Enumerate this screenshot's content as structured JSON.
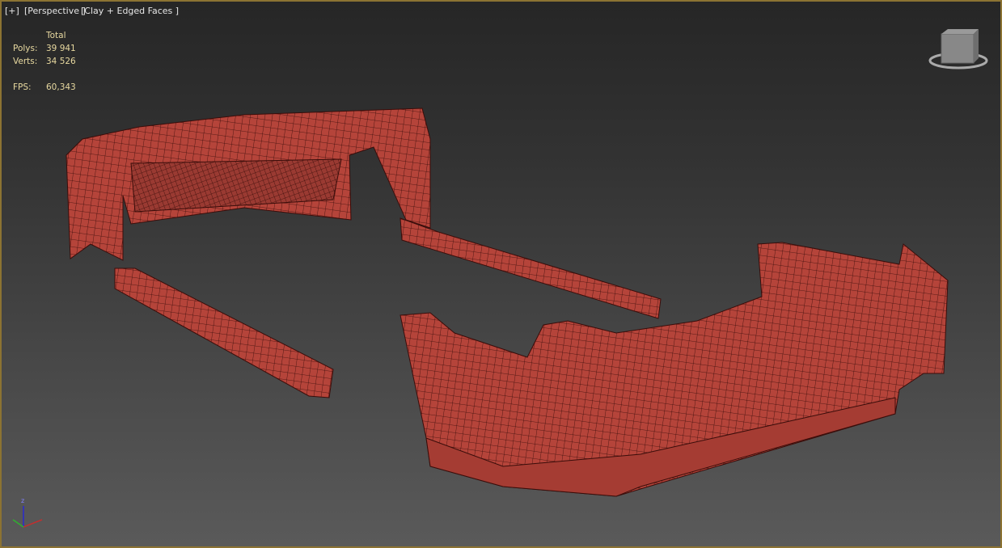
{
  "viewport": {
    "menu_label": "[+]",
    "view_label": "[Perspective ]",
    "shading_label": "[Clay + Edged Faces ]"
  },
  "stats": {
    "header": "Total",
    "polys_label": "Polys:",
    "polys_value": "39 941",
    "verts_label": "Verts:",
    "verts_value": "34 526",
    "fps_label": "FPS:",
    "fps_value": "60,343"
  },
  "gizmo": {
    "z_label": "z"
  },
  "colors": {
    "border": "#8c7332",
    "clay": "#b8463c",
    "wire": "#3a0d0a",
    "stats_text": "#e8d9a0"
  }
}
